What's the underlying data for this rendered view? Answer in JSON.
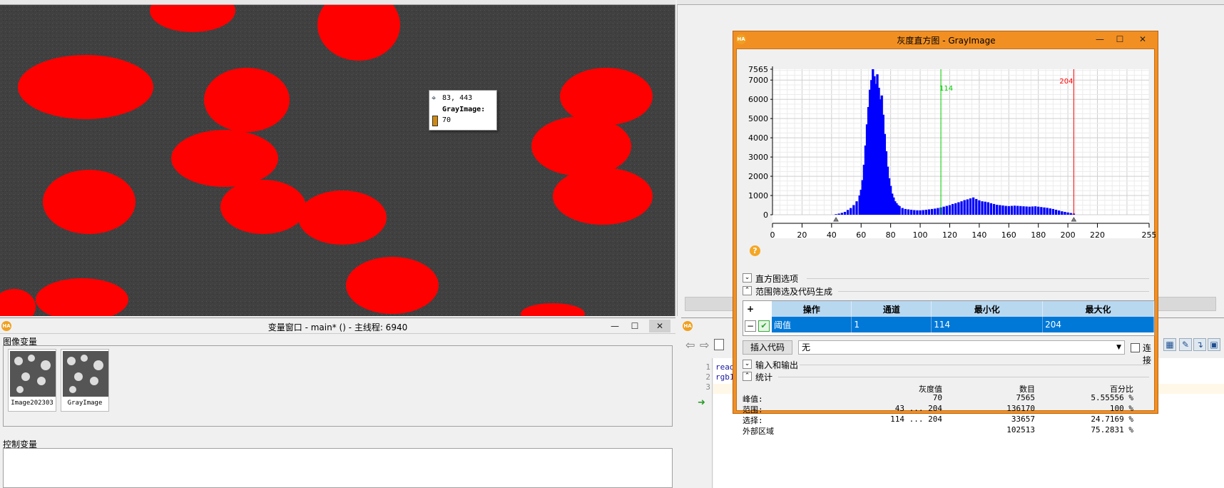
{
  "graphics": {
    "tooltip": {
      "coords": "83, 443",
      "image_name": "GrayImage:",
      "value": "70"
    }
  },
  "variable_window": {
    "title": "变量窗口 - main* () - 主线程: 6940",
    "iconic_group": "图像变量",
    "control_group": "控制变量",
    "iconic_vars": [
      {
        "name": "Image202303"
      },
      {
        "name": "GrayImage"
      }
    ]
  },
  "program_window": {
    "lines": [
      {
        "num": "1",
        "code": "read"
      },
      {
        "num": "2",
        "code": "rgb1"
      },
      {
        "num": "3",
        "code": ""
      }
    ]
  },
  "histogram_dialog": {
    "title": "灰度直方图 - GrayImage",
    "help_icon": "?",
    "sections": {
      "options": "直方图选项",
      "range": "范围筛选及代码生成",
      "io": "输入和输出",
      "stats": "统计"
    },
    "table": {
      "headers": [
        "操作",
        "通道",
        "最小化",
        "最大化"
      ],
      "row": {
        "op": "阈值",
        "channel": "1",
        "min": "114",
        "max": "204"
      }
    },
    "insert_code_label": "插入代码",
    "mode_value": "无",
    "connect_label": "连接",
    "stats_headers": {
      "gray": "灰度值",
      "count": "数目",
      "percent": "百分比"
    },
    "stats_rows": [
      {
        "label": "峰值:",
        "gray": "70",
        "count": "7565",
        "percent": "5.55556 %"
      },
      {
        "label": "范围:",
        "gray": "43 ... 204",
        "count": "136170",
        "percent": "100 %"
      },
      {
        "label": "选择:",
        "gray": "114 ... 204",
        "count": "33657",
        "percent": "24.7169 %"
      },
      {
        "label": "外部区域",
        "gray": "",
        "count": "102513",
        "percent": "75.2831 %"
      }
    ]
  },
  "chart_data": {
    "type": "bar",
    "xlim": [
      0,
      255
    ],
    "ylim": [
      0,
      7565
    ],
    "x_ticks": [
      0,
      20,
      40,
      60,
      80,
      100,
      120,
      140,
      160,
      180,
      200,
      220,
      255
    ],
    "y_ticks": [
      0,
      1000,
      2000,
      3000,
      4000,
      5000,
      6000,
      7000,
      7565
    ],
    "markers": {
      "min": 114,
      "max": 204
    },
    "range_triangles": [
      43,
      204
    ],
    "grid": true,
    "x": [
      43,
      45,
      47,
      49,
      51,
      53,
      55,
      57,
      59,
      60,
      61,
      62,
      63,
      64,
      65,
      66,
      67,
      68,
      69,
      70,
      71,
      72,
      73,
      74,
      75,
      76,
      77,
      78,
      79,
      80,
      81,
      82,
      83,
      84,
      85,
      86,
      88,
      90,
      92,
      94,
      96,
      98,
      100,
      102,
      104,
      106,
      108,
      110,
      112,
      114,
      116,
      118,
      120,
      122,
      124,
      126,
      128,
      130,
      132,
      134,
      136,
      138,
      140,
      142,
      144,
      146,
      148,
      150,
      152,
      154,
      156,
      158,
      160,
      162,
      164,
      166,
      168,
      170,
      172,
      174,
      176,
      178,
      180,
      182,
      184,
      186,
      188,
      190,
      192,
      194,
      196,
      198,
      200,
      202,
      204
    ],
    "values": [
      30,
      60,
      100,
      150,
      250,
      350,
      500,
      700,
      1000,
      1300,
      1800,
      2600,
      3600,
      4700,
      5600,
      6500,
      7000,
      7565,
      7200,
      6800,
      7300,
      6600,
      6000,
      6200,
      5200,
      4200,
      3300,
      2500,
      1900,
      1500,
      1100,
      900,
      700,
      600,
      500,
      450,
      350,
      300,
      280,
      260,
      240,
      230,
      230,
      240,
      260,
      280,
      300,
      320,
      350,
      380,
      420,
      460,
      500,
      560,
      600,
      650,
      700,
      760,
      800,
      850,
      900,
      820,
      750,
      700,
      680,
      650,
      600,
      560,
      520,
      500,
      480,
      460,
      450,
      460,
      470,
      460,
      450,
      440,
      430,
      420,
      430,
      440,
      420,
      400,
      380,
      360,
      330,
      300,
      260,
      220,
      180,
      150,
      120,
      90,
      60
    ]
  },
  "colors": {
    "dialog_frame": "#f28f22",
    "region": "#ff0000",
    "histogram_bar": "#0000ff",
    "min_line": "#00cc00",
    "max_line": "#ff0000",
    "selection": "#0078d7"
  }
}
